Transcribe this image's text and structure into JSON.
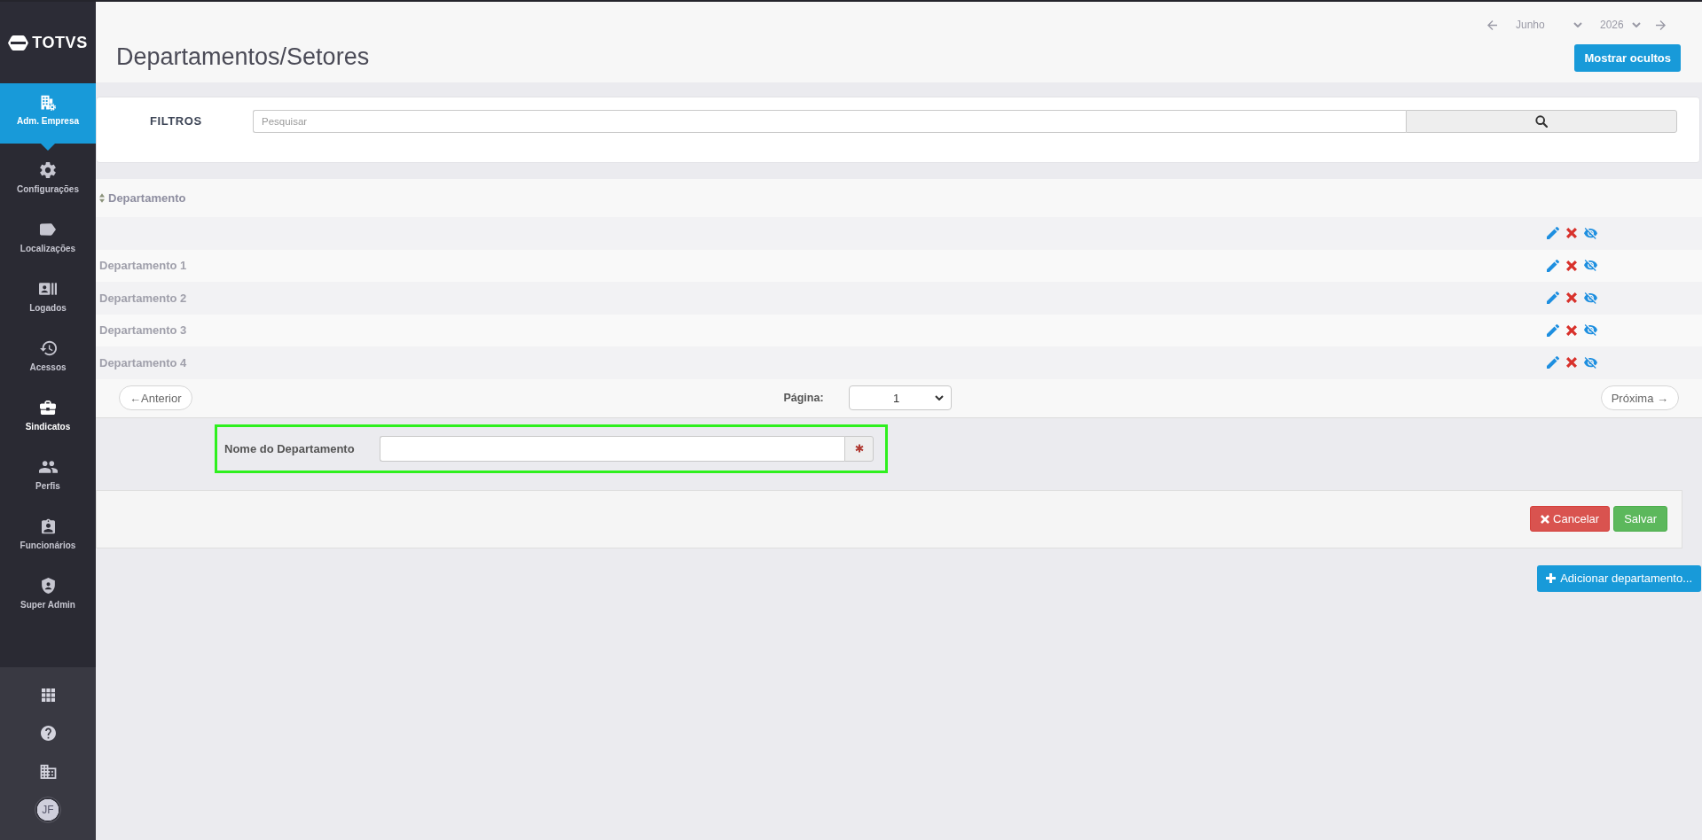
{
  "sidebar": {
    "logo": "TOTVS",
    "items": [
      {
        "label": "Adm. Empresa",
        "selected": true,
        "hovered": false
      },
      {
        "label": "Configurações",
        "selected": false,
        "hovered": false
      },
      {
        "label": "Localizações",
        "selected": false,
        "hovered": false
      },
      {
        "label": "Logados",
        "selected": false,
        "hovered": false
      },
      {
        "label": "Acessos",
        "selected": false,
        "hovered": false
      },
      {
        "label": "Sindicatos",
        "selected": false,
        "hovered": true
      },
      {
        "label": "Perfis",
        "selected": false,
        "hovered": false
      },
      {
        "label": "Funcionários",
        "selected": false,
        "hovered": false
      },
      {
        "label": "Super Admin",
        "selected": false,
        "hovered": false
      }
    ],
    "avatar": "JF"
  },
  "header": {
    "title": "Departamentos/Setores",
    "month_select": {
      "value": "Junho"
    },
    "year_select": {
      "value": "2026"
    },
    "show_hidden_button": "Mostrar ocultos"
  },
  "filters": {
    "label": "FILTROS",
    "search": {
      "placeholder": "Pesquisar"
    }
  },
  "table": {
    "columns": [
      "Departamento"
    ],
    "rows": [
      {},
      {
        "name": "Departamento 1"
      },
      {
        "name": "Departamento 2"
      },
      {
        "name": "Departamento 3"
      },
      {
        "name": "Departamento 4"
      }
    ]
  },
  "pagination": {
    "previous_button": "←Anterior",
    "page_label": "Página:",
    "page_select": {
      "value": "1"
    },
    "next_button": "Próxima →"
  },
  "form": {
    "fields": [
      {
        "label": "Nome do Departamento",
        "required": true,
        "highlighted": true
      }
    ]
  },
  "form_actions": [
    {
      "label": "Cancelar",
      "kind": "cancel"
    },
    {
      "label": "Salvar",
      "kind": "save"
    }
  ],
  "add_button": {
    "label": "Adicionar departamento..."
  }
}
